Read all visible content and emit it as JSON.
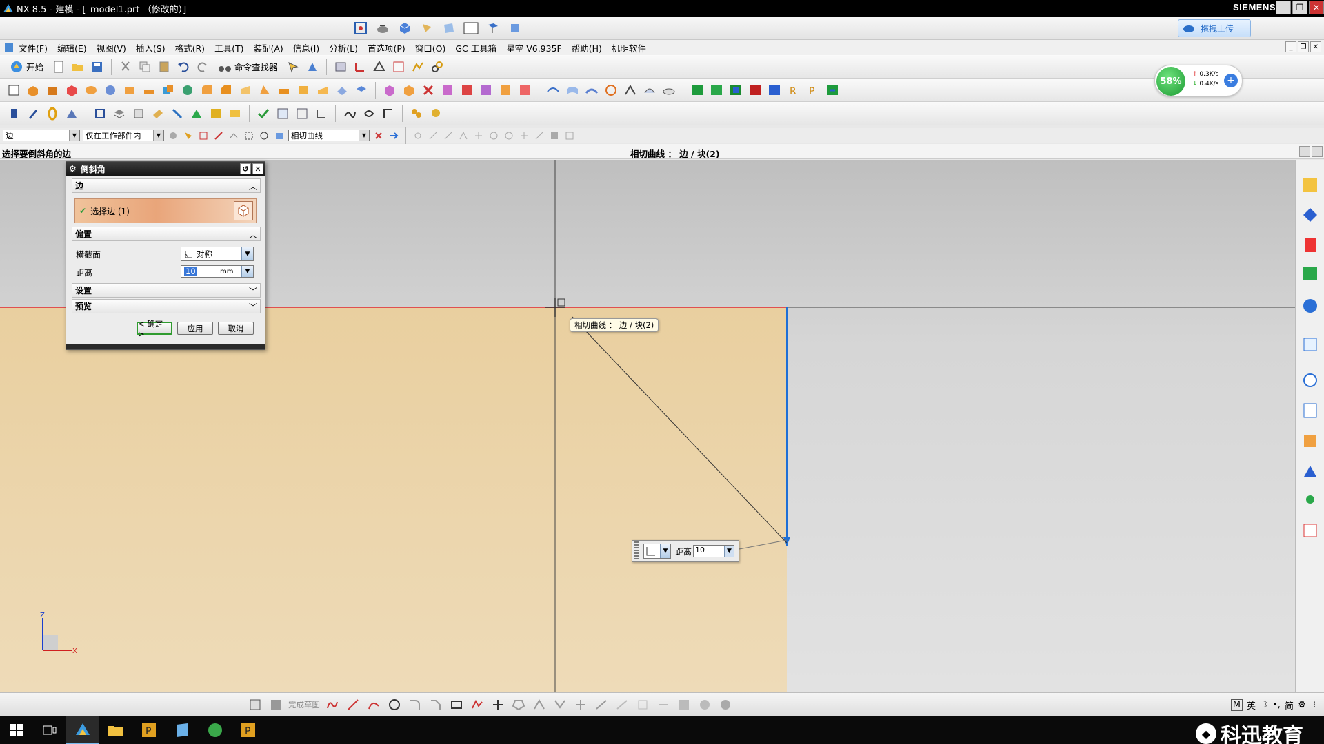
{
  "window": {
    "title": "NX 8.5 - 建模 - [_model1.prt （修改的）]",
    "brand": "SIEMENS",
    "upload_label": "拖拽上传"
  },
  "menu": {
    "items": [
      "文件(F)",
      "编辑(E)",
      "视图(V)",
      "插入(S)",
      "格式(R)",
      "工具(T)",
      "装配(A)",
      "信息(I)",
      "分析(L)",
      "首选项(P)",
      "窗口(O)",
      "GC 工具箱",
      "星空 V6.935F",
      "帮助(H)",
      "机明软件"
    ]
  },
  "toolbar": {
    "start_label": "开始",
    "command_finder_label": "命令查找器"
  },
  "speed_widget": {
    "percent": "58%",
    "up": "0.3K/s",
    "down": "0.4K/s"
  },
  "selection_bar": {
    "filter_type": "边",
    "scope": "仅在工作部件内",
    "curve_rule": "相切曲线"
  },
  "cue_line": {
    "prompt": "选择要倒斜角的边",
    "status": "相切曲线 ： 边 / 块(2)"
  },
  "dialog": {
    "title": "倒斜角",
    "edge_group": "边",
    "select_edge_label": "选择边 (1)",
    "offset_group": "偏置",
    "cross_section_label": "横截面",
    "cross_section_value": "对称",
    "distance_label": "距离",
    "distance_value": "10",
    "distance_unit": "mm",
    "settings_group": "设置",
    "preview_group": "预览",
    "ok_label": "< 确定 >",
    "apply_label": "应用",
    "cancel_label": "取消"
  },
  "tooltip": {
    "text": "相切曲线 ： 边 / 块(2)"
  },
  "onscreen_input": {
    "label": "距离",
    "value": "10"
  },
  "triad": {
    "z_label": "Z",
    "x_label": "X"
  },
  "sketch_toolbar": {
    "finish_label": "完成草图"
  },
  "ime": [
    "M",
    "英",
    "☽",
    "•,",
    "简",
    "⚙",
    "⁝"
  ],
  "taskbar": {
    "brand": "科迅教育"
  },
  "colors": {
    "part_face": "#e8d3ad",
    "edge_highlight": "#e05050",
    "selected_edge": "#1e6fd6",
    "dialog_select_orange": "#e9a57a"
  }
}
